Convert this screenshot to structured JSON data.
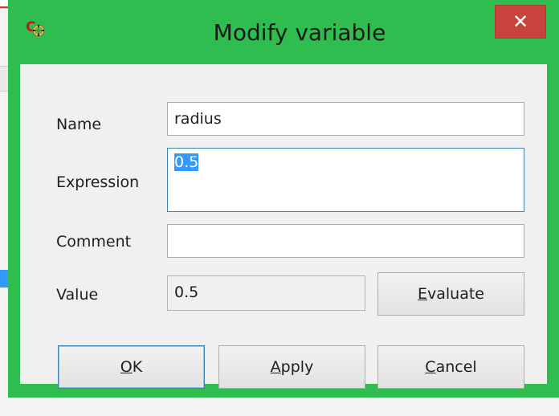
{
  "dialog": {
    "title": "Modify variable",
    "close_symbol": "✕",
    "app_icon": "freecad-spreadsheet-icon"
  },
  "form": {
    "name_label": "Name",
    "name_value": "radius",
    "expression_label": "Expression",
    "expression_value": "0.5",
    "comment_label": "Comment",
    "comment_value": "",
    "value_label": "Value",
    "value_value": "0.5"
  },
  "buttons": {
    "evaluate": {
      "mnemonic": "E",
      "rest": "valuate"
    },
    "ok": {
      "mnemonic": "O",
      "rest": "K"
    },
    "apply": {
      "mnemonic": "A",
      "rest": "pply"
    },
    "cancel": {
      "mnemonic": "C",
      "rest": "ancel"
    }
  },
  "colors": {
    "frame": "#2ebd4e",
    "close": "#c7433b",
    "selection": "#3399ff",
    "focus": "#3c7fb1"
  }
}
